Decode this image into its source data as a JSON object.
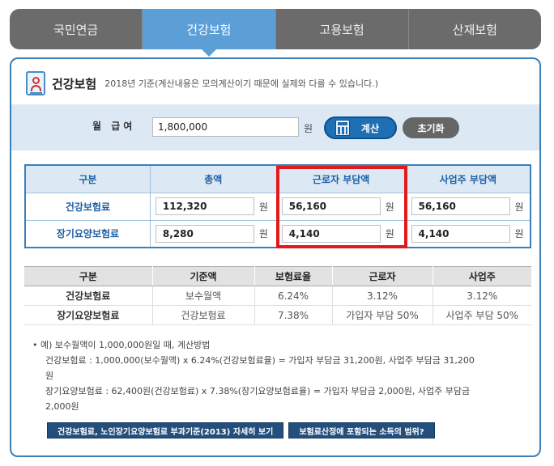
{
  "tabs": [
    {
      "label": "국민연금"
    },
    {
      "label": "건강보험"
    },
    {
      "label": "고용보험"
    },
    {
      "label": "산재보험"
    }
  ],
  "header": {
    "title": "건강보험",
    "description": "2018년 기준(계산내용은 모의계산이기 때문에 실제와 다를 수 있습니다.)",
    "icon": "id-card-icon"
  },
  "calc": {
    "label": "월 급여",
    "salary_value": "1,800,000",
    "unit": "원",
    "calc_button": "계산",
    "reset_button": "초기화"
  },
  "result_table": {
    "headers": [
      "구분",
      "총액",
      "근로자 부담액",
      "사업주 부담액"
    ],
    "unit": "원",
    "rows": [
      {
        "label": "건강보험료",
        "total": "112,320",
        "worker": "56,160",
        "employer": "56,160"
      },
      {
        "label": "장기요양보험료",
        "total": "8,280",
        "worker": "4,140",
        "employer": "4,140"
      }
    ],
    "highlight_color": "#e11a1a"
  },
  "rate_table": {
    "headers": [
      "구분",
      "기준액",
      "보험료율",
      "근로자",
      "사업주"
    ],
    "rows": [
      {
        "label": "건강보험료",
        "base": "보수월액",
        "rate": "6.24%",
        "worker": "3.12%",
        "employer": "3.12%"
      },
      {
        "label": "장기요양보험료",
        "base": "건강보험료",
        "rate": "7.38%",
        "worker": "가입자 부담 50%",
        "employer": "사업주 부담 50%"
      }
    ]
  },
  "notes": {
    "line1": "예) 보수월액이 1,000,000원일 때, 계산방법",
    "line2": "건강보험료 : 1,000,000(보수월액) x 6.24%(건강보험료율) = 가입자 부담금 31,200원, 사업주 부담금 31,200",
    "line3": "원",
    "line4": "장기요양보험료 : 62,400원(건강보험료) x 7.38%(장기요양보험료율) = 가입자 부담금 2,000원, 사업주 부담금",
    "line5": "2,000원"
  },
  "links": {
    "link1": "건강보험료, 노인장기요양보험료 부과기준(2013) 자세히 보기",
    "link2": "보험료산정에 포함되는 소득의 범위?"
  },
  "colors": {
    "accent": "#5b9fd6",
    "border": "#3a7fb8",
    "tab_bg": "#6b6b6b"
  }
}
